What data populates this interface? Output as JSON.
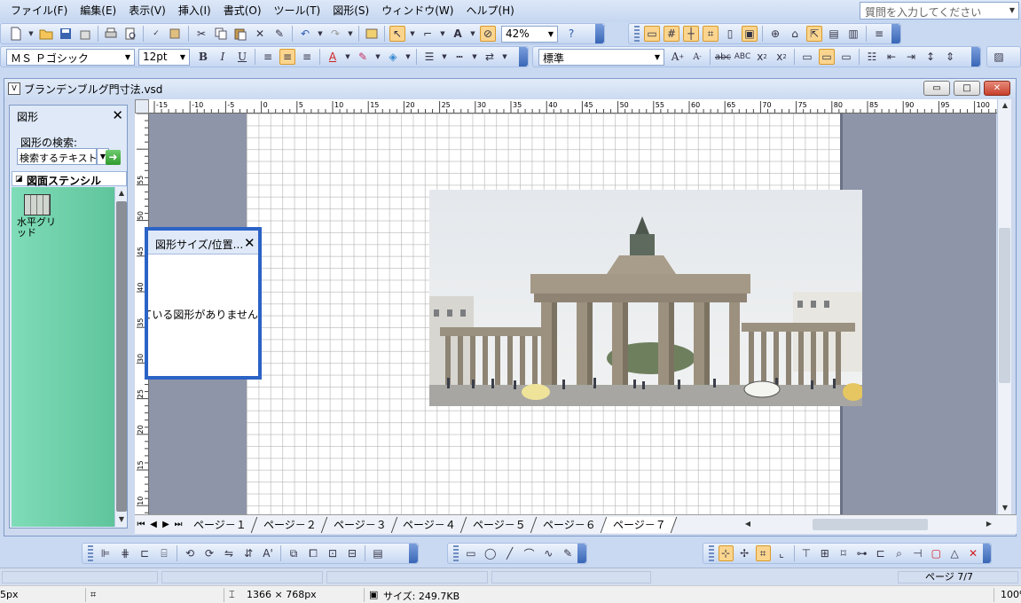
{
  "menubar": {
    "items": [
      "ファイル(F)",
      "編集(E)",
      "表示(V)",
      "挿入(I)",
      "書式(O)",
      "ツール(T)",
      "図形(S)",
      "ウィンドウ(W)",
      "ヘルプ(H)"
    ],
    "help_placeholder": "質問を入力してください"
  },
  "toolbar": {
    "zoom": "42%",
    "font": "ＭＳ Ｐゴシック",
    "font_size": "12pt",
    "style": "標準"
  },
  "document": {
    "title": "ブランデンブルグ門寸法.vsd",
    "minimize_label": "▭",
    "restore_label": "□",
    "close_label": "✕"
  },
  "shapes_panel": {
    "title": "図形",
    "search_label": "図形の検索:",
    "search_placeholder": "検索するテキスト",
    "stencil_title": "図面ステンシル",
    "shape_label": "水平グリッド"
  },
  "size_panel": {
    "title": "図形サイズ/位置...",
    "message": "選択されている図形がありません"
  },
  "ruler": {
    "h_labels": [
      "-15",
      "-10",
      "-5",
      "0",
      "5",
      "10",
      "15",
      "20",
      "25",
      "30",
      "35",
      "40",
      "45",
      "50",
      "55",
      "60",
      "65",
      "70",
      "75",
      "80",
      "85",
      "90",
      "95",
      "100"
    ],
    "v_labels": [
      "55",
      "50",
      "45",
      "40",
      "35",
      "30",
      "25",
      "20",
      "15",
      "10"
    ]
  },
  "page_tabs": {
    "tabs": [
      "ページ－１",
      "ページ－２",
      "ページ－３",
      "ページ－４",
      "ページ－５",
      "ページ－６",
      "ページ－７"
    ],
    "active_index": 6
  },
  "statusbar": {
    "page_indicator": "ページ 7/7"
  },
  "os_status": {
    "cursor": "5px",
    "dimensions": "1366 × 768px",
    "size": "サイズ: 249.7KB",
    "zoom": "100%"
  },
  "colors": {
    "accent": "#2b63c6",
    "stencil": "#7fdcb8",
    "canvas_bg": "#8e95a8"
  }
}
